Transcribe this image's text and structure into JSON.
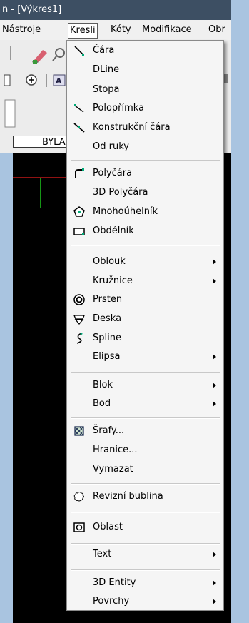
{
  "window": {
    "title": "n - [Výkres1]"
  },
  "menubar": {
    "items": [
      "Nástroje",
      "Kresli",
      "Kóty",
      "Modifikace",
      "Obr"
    ],
    "active": "Kresli"
  },
  "layer_box": {
    "value": "BYLA"
  },
  "menu": {
    "items": [
      {
        "label": "Čára",
        "icon": "line-icon"
      },
      {
        "label": "DLine",
        "icon": ""
      },
      {
        "label": "Stopa",
        "icon": ""
      },
      {
        "label": "Polopřímka",
        "icon": "ray-icon"
      },
      {
        "label": "Konstrukční čára",
        "icon": "construction-line-icon"
      },
      {
        "label": "Od ruky",
        "icon": ""
      },
      {
        "label": "Polyčára",
        "icon": "polyline-icon"
      },
      {
        "label": "3D Polyčára",
        "icon": ""
      },
      {
        "label": "Mnohoúhelník",
        "icon": "polygon-icon"
      },
      {
        "label": "Obdélník",
        "icon": "rectangle-icon"
      },
      {
        "label": "Oblouk",
        "icon": "",
        "submenu": true
      },
      {
        "label": "Kružnice",
        "icon": "",
        "submenu": true
      },
      {
        "label": "Prsten",
        "icon": "donut-icon"
      },
      {
        "label": "Deska",
        "icon": "plane-icon"
      },
      {
        "label": "Spline",
        "icon": "spline-icon"
      },
      {
        "label": "Elipsa",
        "icon": "",
        "submenu": true
      },
      {
        "label": "Blok",
        "icon": "",
        "submenu": true
      },
      {
        "label": "Bod",
        "icon": "",
        "submenu": true
      },
      {
        "label": "Šrafy...",
        "icon": "hatch-icon"
      },
      {
        "label": "Hranice...",
        "icon": ""
      },
      {
        "label": "Vymazat",
        "icon": ""
      },
      {
        "label": "Revizní bublina",
        "icon": "revision-cloud-icon"
      },
      {
        "label": "Oblast",
        "icon": "region-icon"
      },
      {
        "label": "Text",
        "icon": "",
        "submenu": true
      },
      {
        "label": "3D Entity",
        "icon": "",
        "submenu": true
      },
      {
        "label": "Povrchy",
        "icon": "",
        "submenu": true
      }
    ]
  },
  "colors": {
    "title_bar": "#3d4f63",
    "menu_bg": "#f5f5f5",
    "frame": "#a9c4e0",
    "canvas": "#000000"
  }
}
